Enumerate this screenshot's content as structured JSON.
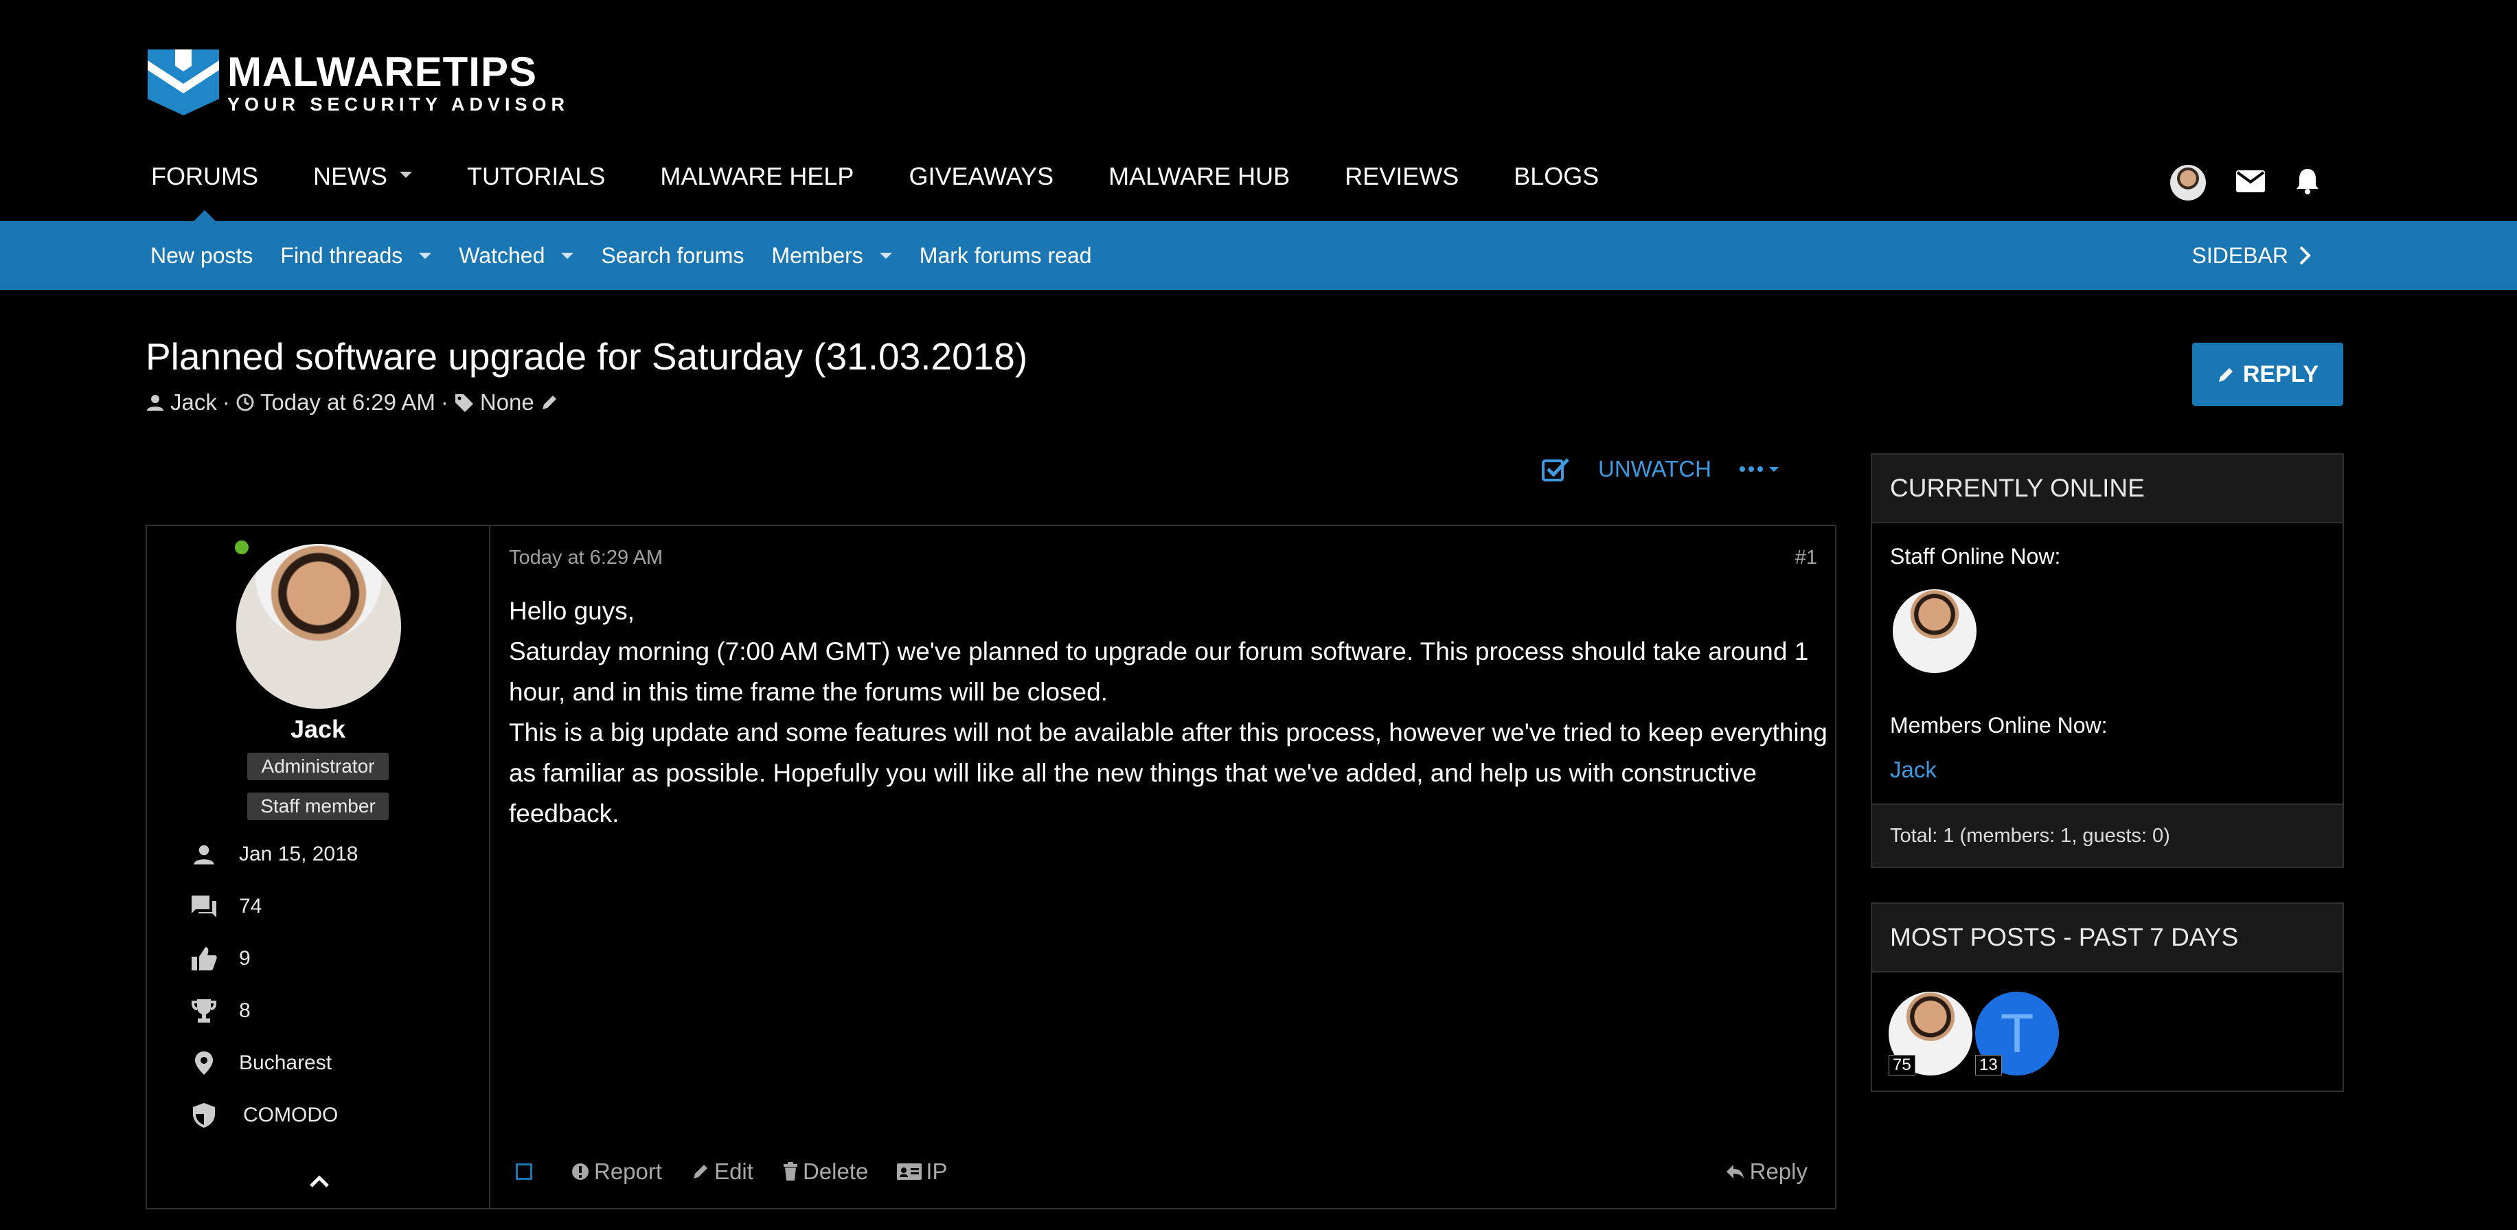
{
  "brand": {
    "title": "MALWARETIPS",
    "subtitle": "YOUR SECURITY ADVISOR"
  },
  "topnav": {
    "items": [
      {
        "label": "FORUMS"
      },
      {
        "label": "NEWS"
      },
      {
        "label": "TUTORIALS"
      },
      {
        "label": "MALWARE HELP"
      },
      {
        "label": "GIVEAWAYS"
      },
      {
        "label": "MALWARE HUB"
      },
      {
        "label": "REVIEWS"
      },
      {
        "label": "BLOGS"
      }
    ]
  },
  "subnav": {
    "items": [
      {
        "label": "New posts"
      },
      {
        "label": "Find threads"
      },
      {
        "label": "Watched"
      },
      {
        "label": "Search forums"
      },
      {
        "label": "Members"
      },
      {
        "label": "Mark forums read"
      }
    ],
    "sidebar_label": "SIDEBAR"
  },
  "thread": {
    "title": "Planned software upgrade for Saturday (31.03.2018)",
    "author": "Jack",
    "time": "Today at 6:29 AM",
    "tags": "None",
    "reply_label": "REPLY",
    "unwatch_label": "UNWATCH"
  },
  "post": {
    "date": "Today at 6:29 AM",
    "number": "#1",
    "paragraphs": [
      "Hello guys,",
      "Saturday morning (7:00 AM GMT) we've planned to upgrade our forum software. This process should take around 1 hour, and in this time frame the forums will be closed.",
      "This is a big update and some features will not be available after this process, however we've tried to keep everything as familiar as possible. Hopefully you will like all the new things that we've added, and help us with constructive feedback."
    ],
    "actions": {
      "report": "Report",
      "edit": "Edit",
      "delete": "Delete",
      "ip": "IP",
      "reply": "Reply"
    }
  },
  "user": {
    "name": "Jack",
    "badges": [
      "Administrator",
      "Staff member"
    ],
    "joined": "Jan 15, 2018",
    "messages": "74",
    "reactions": "9",
    "points": "8",
    "location": "Bucharest",
    "security": "COMODO"
  },
  "online": {
    "heading": "CURRENTLY ONLINE",
    "staff_label": "Staff Online Now:",
    "members_label": "Members Online Now:",
    "member_name": "Jack",
    "total": "Total: 1 (members: 1, guests: 0)"
  },
  "most_posts": {
    "heading": "MOST POSTS - PAST 7 DAYS",
    "users": [
      {
        "count": "75"
      },
      {
        "initial": "T",
        "count": "13"
      }
    ]
  },
  "colors": {
    "accent": "#1b77b4",
    "link": "#3d9ae0",
    "online": "#63b52a"
  }
}
